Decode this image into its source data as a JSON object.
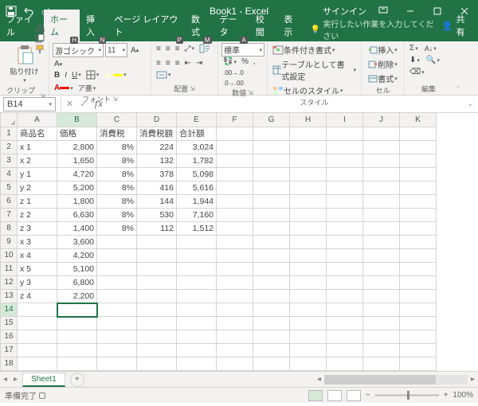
{
  "title": "Book1 - Excel",
  "signin": "サインイン",
  "tabs": {
    "file": "ファイル",
    "home": "ホーム",
    "insert": "挿入",
    "pagelayout": "ページ レイアウト",
    "formulas": "数式",
    "data": "データ",
    "review": "校閲",
    "view": "表示",
    "tellme": "実行したい作業を入力してください",
    "share": "共有",
    "badges": {
      "home": "H",
      "insert": "N",
      "pagelayout": "P",
      "formulas": "M",
      "data": "A"
    }
  },
  "ribbon": {
    "paste": "貼り付け",
    "clipboard": "クリップボード",
    "font_group": "フォント",
    "align_group": "配置",
    "number_group": "数値",
    "styles_group": "スタイル",
    "cells_group": "セル",
    "editing_group": "編集",
    "font_name": "游ゴシック",
    "font_size": "11",
    "number_format": "標準",
    "cond_format": "条件付き書式",
    "table_format": "テーブルとして書式設定",
    "cell_styles": "セルのスタイル",
    "insert": "挿入",
    "delete": "削除",
    "format": "書式"
  },
  "namebox": "B14",
  "columns": [
    "A",
    "B",
    "C",
    "D",
    "E",
    "F",
    "G",
    "H",
    "I",
    "J",
    "K"
  ],
  "row_nums": [
    1,
    2,
    3,
    4,
    5,
    6,
    7,
    8,
    9,
    10,
    11,
    12,
    13,
    14,
    15,
    16,
    17,
    18
  ],
  "headers": {
    "A": "商品名",
    "B": "価格",
    "C": "消費税",
    "D": "消費税額",
    "E": "合計額"
  },
  "data": [
    {
      "A": "x 1",
      "B": "2,800",
      "C": "8%",
      "D": "224",
      "E": "3,024"
    },
    {
      "A": "x 2",
      "B": "1,650",
      "C": "8%",
      "D": "132",
      "E": "1,782"
    },
    {
      "A": "y 1",
      "B": "4,720",
      "C": "8%",
      "D": "378",
      "E": "5,098"
    },
    {
      "A": "y 2",
      "B": "5,200",
      "C": "8%",
      "D": "416",
      "E": "5,616"
    },
    {
      "A": "z 1",
      "B": "1,800",
      "C": "8%",
      "D": "144",
      "E": "1,944"
    },
    {
      "A": "z 2",
      "B": "6,630",
      "C": "8%",
      "D": "530",
      "E": "7,160"
    },
    {
      "A": "z 3",
      "B": "1,400",
      "C": "8%",
      "D": "112",
      "E": "1,512"
    },
    {
      "A": "x 3",
      "B": "3,600"
    },
    {
      "A": "x 4",
      "B": "4,200"
    },
    {
      "A": "x 5",
      "B": "5,100"
    },
    {
      "A": "y 3",
      "B": "6,800"
    },
    {
      "A": "z 4",
      "B": "2,200"
    }
  ],
  "selected": {
    "col": "B",
    "row": 14
  },
  "sheet_tab": "Sheet1",
  "status": "準備完了",
  "zoom": "100%"
}
